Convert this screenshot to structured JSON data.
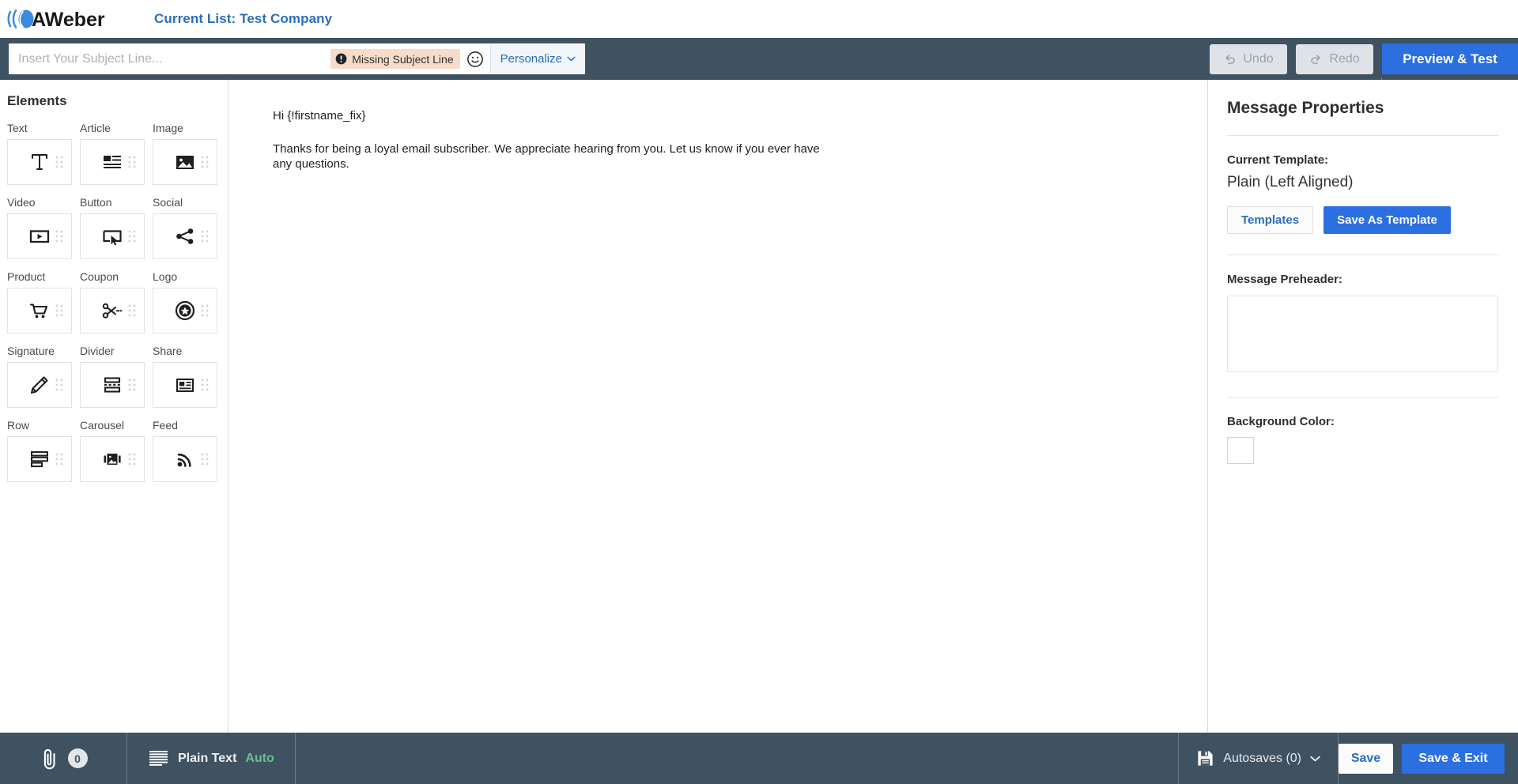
{
  "brand": {
    "name": "AWeber",
    "logo_blue": "#3c8ae0",
    "accent_blue": "#2b6fe0",
    "link_blue": "#2a6ebb",
    "bar_dark": "#3f5261",
    "warn_bg": "#f7ddc9",
    "auto_green": "#6abf8e"
  },
  "header": {
    "current_list_label": "Current List: Test Company"
  },
  "subject": {
    "placeholder": "Insert Your Subject Line...",
    "value": "",
    "warning_text": "Missing Subject Line",
    "warning_icon": "exclamation-circle-icon",
    "emoji_icon": "smiley-icon",
    "personalize_label": "Personalize",
    "personalize_icon": "chevron-down-icon",
    "undo_label": "Undo",
    "undo_icon": "undo-arrow-icon",
    "redo_label": "Redo",
    "redo_icon": "redo-arrow-icon",
    "preview_label": "Preview & Test"
  },
  "sidebar": {
    "title": "Elements",
    "items": [
      {
        "label": "Text",
        "icon": "text-t-icon"
      },
      {
        "label": "Article",
        "icon": "article-icon"
      },
      {
        "label": "Image",
        "icon": "image-icon"
      },
      {
        "label": "Video",
        "icon": "video-play-icon"
      },
      {
        "label": "Button",
        "icon": "button-cursor-icon"
      },
      {
        "label": "Social",
        "icon": "social-share-nodes-icon"
      },
      {
        "label": "Product",
        "icon": "shopping-cart-icon"
      },
      {
        "label": "Coupon",
        "icon": "scissors-icon"
      },
      {
        "label": "Logo",
        "icon": "star-badge-icon"
      },
      {
        "label": "Signature",
        "icon": "pencil-signature-icon"
      },
      {
        "label": "Divider",
        "icon": "divider-icon"
      },
      {
        "label": "Share",
        "icon": "newspaper-share-icon"
      },
      {
        "label": "Row",
        "icon": "row-layout-icon"
      },
      {
        "label": "Carousel",
        "icon": "carousel-icon"
      },
      {
        "label": "Feed",
        "icon": "rss-feed-icon"
      }
    ]
  },
  "canvas": {
    "greeting": "Hi {!firstname_fix}",
    "paragraph": "Thanks for being a loyal email subscriber. We appreciate hearing from you. Let us know if you ever have any questions."
  },
  "properties": {
    "title": "Message Properties",
    "current_template_label": "Current Template:",
    "current_template_value": "Plain (Left Aligned)",
    "templates_button": "Templates",
    "save_as_template_button": "Save As Template",
    "preheader_label": "Message Preheader:",
    "preheader_value": "",
    "preheader_placeholder": "",
    "background_color_label": "Background Color:",
    "background_color_value": "#ffffff"
  },
  "footer": {
    "attachment_icon": "paperclip-icon",
    "attachment_count": "0",
    "plain_text_icon": "text-lines-icon",
    "plain_text_label": "Plain Text",
    "plain_text_mode": "Auto",
    "autosaves_icon": "floppy-disk-icon",
    "autosaves_label": "Autosaves (0)",
    "autosaves_chevron": "chevron-down-icon",
    "save_label": "Save",
    "save_exit_label": "Save & Exit"
  }
}
